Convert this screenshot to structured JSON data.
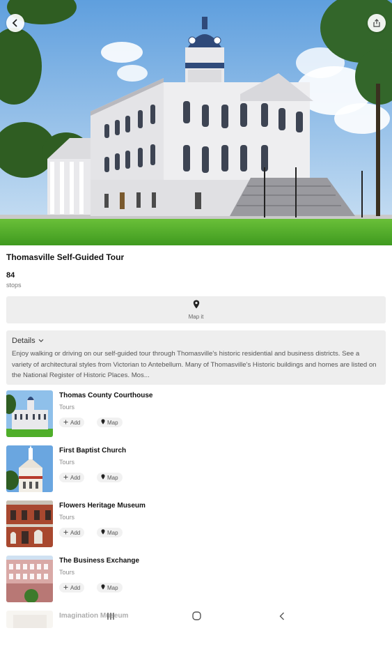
{
  "header": {
    "back_icon": "chevron-left-icon",
    "share_icon": "share-icon"
  },
  "tour": {
    "title": "Thomasville Self-Guided Tour",
    "stop_count": "84",
    "stop_label": "stops"
  },
  "map_button": {
    "label": "Map it",
    "icon": "map-pin-icon"
  },
  "details": {
    "heading": "Details",
    "text": "Enjoy walking or driving on our self-guided tour through Thomasville's historic residential and business districts. See a variety of architectural styles from Victorian to Antebellum. Many of Thomasville's Historic buildings and homes are listed on the National Register of Historic Places. Mos..."
  },
  "stops": [
    {
      "name": "Thomas County Courthouse",
      "category": "Tours",
      "add_label": "Add",
      "map_label": "Map"
    },
    {
      "name": "First Baptist Church",
      "category": "Tours",
      "add_label": "Add",
      "map_label": "Map"
    },
    {
      "name": "Flowers Heritage Museum",
      "category": "Tours",
      "add_label": "Add",
      "map_label": "Map"
    },
    {
      "name": "The Business Exchange",
      "category": "Tours",
      "add_label": "Add",
      "map_label": "Map"
    },
    {
      "name": "Imagination Museum",
      "category": "",
      "add_label": "",
      "map_label": ""
    }
  ],
  "system_nav": {
    "recents_icon": "recents-icon",
    "home_icon": "home-icon",
    "back_icon": "back-icon"
  },
  "colors": {
    "sky": "#7fb6e8",
    "grass": "#4fae2a",
    "building": "#e7e7e9",
    "dome": "#2f4a7a",
    "card_bg": "#eeeeee"
  }
}
